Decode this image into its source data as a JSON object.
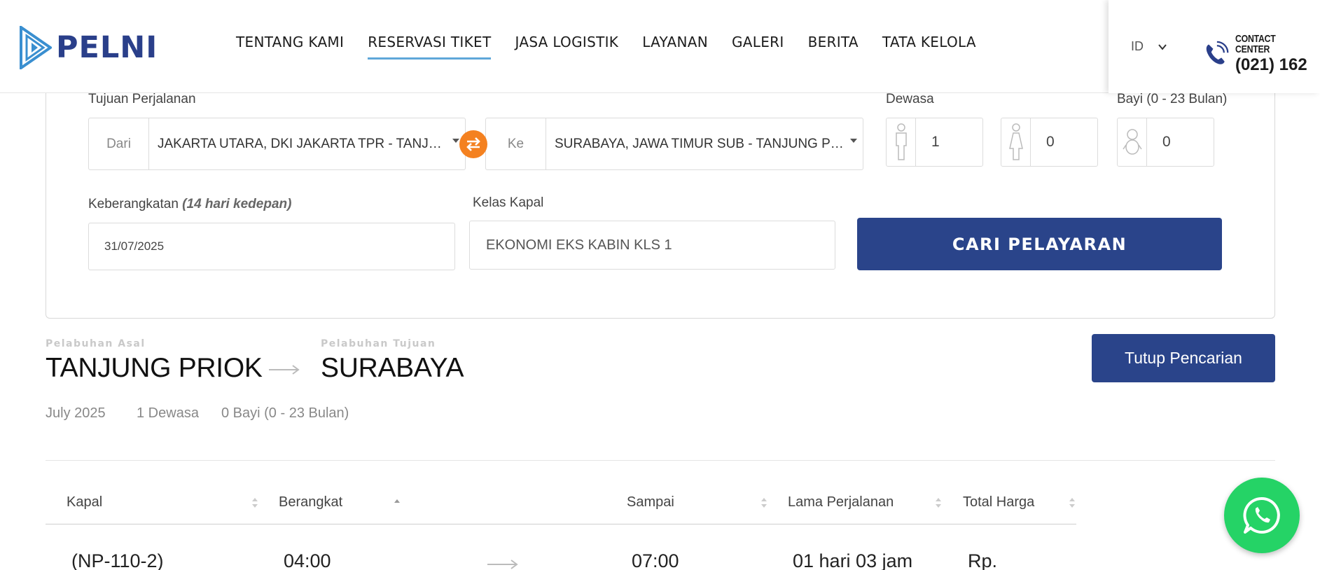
{
  "brand": {
    "name": "PELNI",
    "color": "#2a3f8a"
  },
  "nav": {
    "items": [
      {
        "label": "TENTANG KAMI",
        "active": false
      },
      {
        "label": "RESERVASI TIKET",
        "active": true
      },
      {
        "label": "JASA LOGISTIK",
        "active": false
      },
      {
        "label": "LAYANAN",
        "active": false
      },
      {
        "label": "GALERI",
        "active": false
      },
      {
        "label": "BERITA",
        "active": false
      },
      {
        "label": "TATA KELOLA",
        "active": false
      }
    ]
  },
  "language": {
    "current": "ID",
    "icon": "chevron-down-icon"
  },
  "contact_center": {
    "label": "CONTACT CENTER",
    "number": "(021) 162",
    "icon": "phone-icon"
  },
  "search": {
    "destination_label": "Tujuan Perjalanan",
    "from_prefix": "Dari",
    "from_value": "JAKARTA UTARA, DKI JAKARTA TPR - TANJUNG PRIOK",
    "to_prefix": "Ke",
    "to_value": "SURABAYA, JAWA TIMUR SUB - TANJUNG PERAK",
    "swap_icon": "swap-icon",
    "adult_label": "Dewasa",
    "adult_count": "1",
    "child_count": "0",
    "infant_label": "Bayi (0 - 23 Bulan)",
    "infant_count": "0",
    "departure_label": "Keberangkatan",
    "departure_hint": "(14 hari kedepan)",
    "departure_value": "31/07/2025",
    "class_label": "Kelas Kapal",
    "class_value": "EKONOMI EKS KABIN KLS 1",
    "search_button": "CARI PELAYARAN"
  },
  "summary": {
    "origin_caption": "Pelabuhan Asal",
    "origin": "TANJUNG PRIOK",
    "dest_caption": "Pelabuhan Tujuan",
    "destination": "SURABAYA",
    "close_button": "Tutup Pencarian",
    "month": "July 2025",
    "adults": "1 Dewasa",
    "infants": "0 Bayi (0 - 23 Bulan)"
  },
  "table": {
    "headers": [
      "Kapal",
      "Berangkat",
      "Sampai",
      "Lama Perjalanan",
      "Total Harga"
    ],
    "rows": [
      {
        "ship": "(NP-110-2)",
        "depart": "04:00",
        "arrive": "07:00",
        "duration": "01 hari 03 jam",
        "price": "Rp."
      }
    ]
  },
  "colors": {
    "primary": "#2a448a",
    "accent": "#f48120",
    "active_underline": "#5fa7d9",
    "whatsapp": "#25d366"
  }
}
